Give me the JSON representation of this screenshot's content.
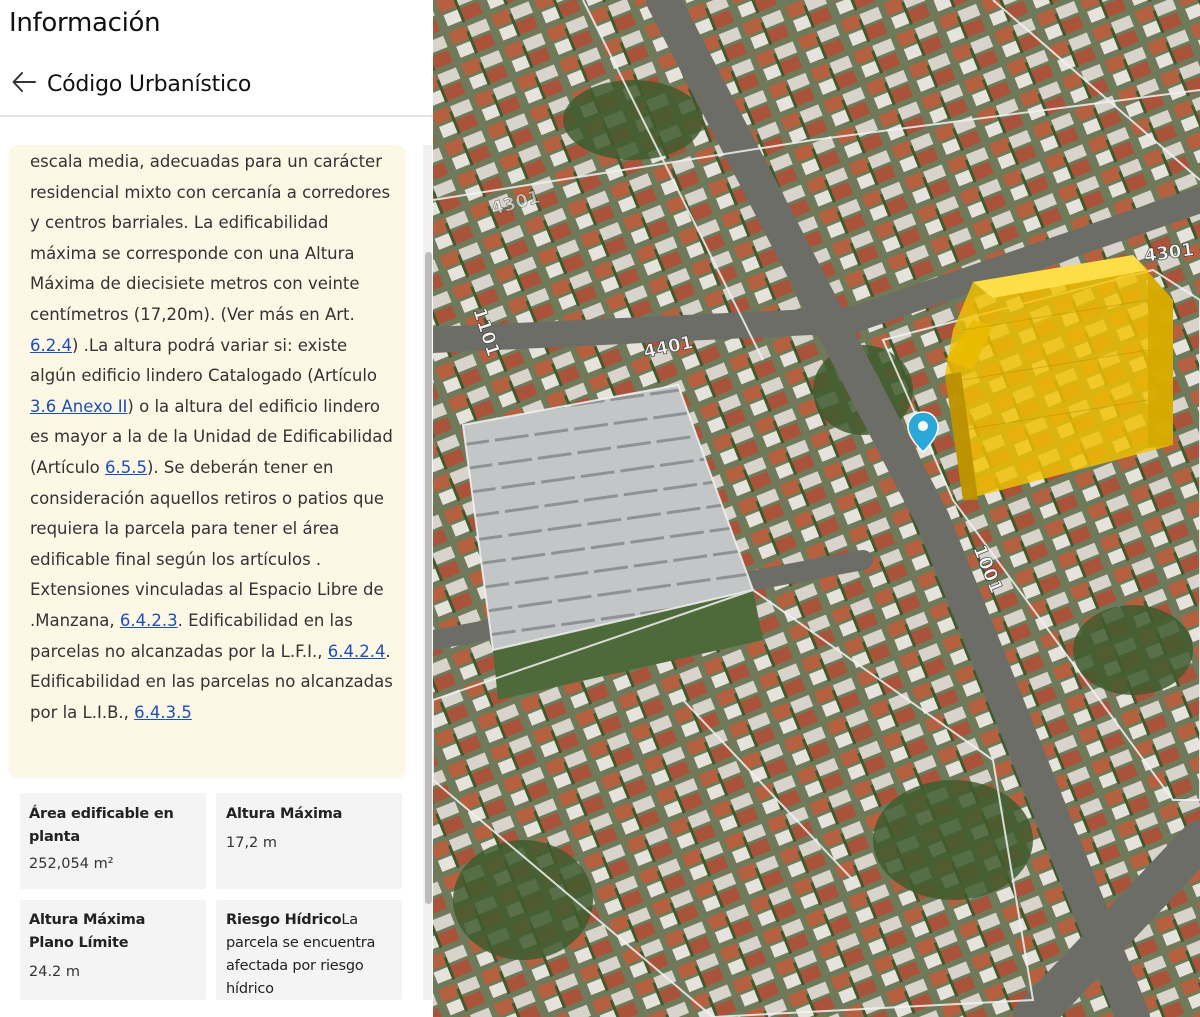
{
  "panel": {
    "title": "Información",
    "section_title": "Código Urbanístico",
    "back_icon": "arrow-left-icon"
  },
  "description": {
    "t1": "escala media, adecuadas para un carácter residencial mixto con cercanía a corredores y centros barriales. La edificabilidad máxima se corresponde con una Altura Máxima de diecisiete metros con veinte centímetros (17,20m). (Ver más en Art. ",
    "link1": "6.2.4",
    "t2": ") .La altura podrá variar si: existe algún edificio lindero Catalogado (Artículo ",
    "link2": "3.6 Anexo II",
    "t3": ") o la altura del edificio lindero es mayor a la de la Unidad de Edificabilidad (Artículo ",
    "link3": "6.5.5",
    "t4": "). Se deberán tener en consideración aquellos retiros o patios que requiera la parcela para tener el área edificable final según los artículos . Extensiones vinculadas al Espacio Libre de .Manzana, ",
    "link4": "6.4.2.3",
    "t5": ". Edificabilidad en las parcelas no alcanzadas por la L.F.I., ",
    "link5": "6.4.2.4",
    "t6": ". Edificabilidad en las parcelas no alcanzadas por la L.I.B., ",
    "link6": "6.4.3.5"
  },
  "stats": {
    "area": {
      "label": "Área edificable en planta",
      "value": "252,054 m²"
    },
    "altura": {
      "label": "Altura Máxima",
      "value": "17,2 m"
    },
    "plano": {
      "label": "Altura Máxima Plano Límite",
      "value": "24.2 m"
    },
    "riesgo": {
      "label": "Riesgo Hídrico",
      "text": "La parcela se encuentra afectada por riesgo hídrico"
    }
  },
  "map": {
    "street_labels": [
      "4301",
      "1101",
      "4401",
      "1001",
      "4301"
    ],
    "marker_color": "#2aa8d8",
    "building_color": "#f2c200",
    "marker_icon": "map-pin-icon"
  }
}
